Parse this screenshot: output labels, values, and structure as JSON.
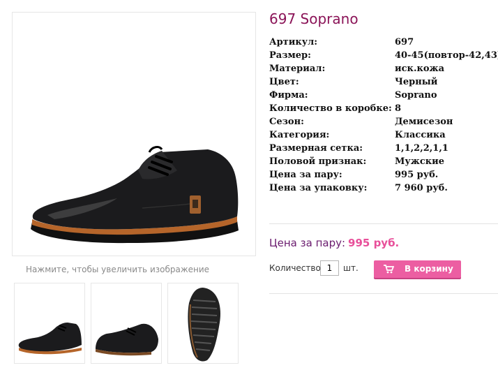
{
  "product": {
    "title": "697 Soprano",
    "zoom_hint": "Нажмите, чтобы увеличить изображение",
    "images": {
      "main": "product-photo-side",
      "thumbs": [
        "thumb-side-view",
        "thumb-back-view",
        "thumb-sole-view"
      ]
    }
  },
  "specs": [
    {
      "label": "Артикул:",
      "value": "697"
    },
    {
      "label": "Размер:",
      "value": "40-45(повтор-42,43)"
    },
    {
      "label": "Материал:",
      "value": "иск.кожа"
    },
    {
      "label": "Цвет:",
      "value": "Черный"
    },
    {
      "label": "Фирма:",
      "value": "Soprano"
    },
    {
      "label": "Количество в коробке:",
      "value": "8"
    },
    {
      "label": "Сезон:",
      "value": "Демисезон"
    },
    {
      "label": "Категория:",
      "value": "Классика"
    },
    {
      "label": "Размерная сетка:",
      "value": "1,1,2,2,1,1"
    },
    {
      "label": "Половой признак:",
      "value": "Мужские"
    },
    {
      "label": "Цена за пару:",
      "value": "995 руб."
    },
    {
      "label": "Цена за упаковку:",
      "value": "7 960 руб."
    }
  ],
  "price": {
    "label": "Цена за пару:",
    "amount": "995 руб."
  },
  "cart": {
    "qty_label": "Количество",
    "qty_value": "1",
    "qty_unit": "шт.",
    "button_label": "В корзину",
    "button_icon": "cart-icon"
  },
  "colors": {
    "title": "#8b1458",
    "price_amount": "#e8509a",
    "button": "#ec5ea2"
  }
}
